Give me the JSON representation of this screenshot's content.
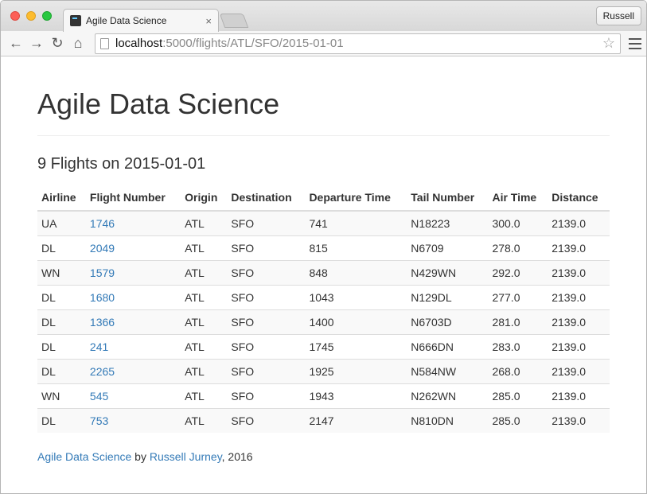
{
  "browser": {
    "tab_title": "Agile Data Science",
    "tab_close": "×",
    "profile": "Russell",
    "url_host": "localhost",
    "url_path": ":5000/flights/ATL/SFO/2015-01-01"
  },
  "page": {
    "heading": "Agile Data Science",
    "subheading": "9 Flights on 2015-01-01"
  },
  "table": {
    "headers": [
      "Airline",
      "Flight Number",
      "Origin",
      "Destination",
      "Departure Time",
      "Tail Number",
      "Air Time",
      "Distance"
    ],
    "rows": [
      [
        "UA",
        "1746",
        "ATL",
        "SFO",
        "741",
        "N18223",
        "300.0",
        "2139.0"
      ],
      [
        "DL",
        "2049",
        "ATL",
        "SFO",
        "815",
        "N6709",
        "278.0",
        "2139.0"
      ],
      [
        "WN",
        "1579",
        "ATL",
        "SFO",
        "848",
        "N429WN",
        "292.0",
        "2139.0"
      ],
      [
        "DL",
        "1680",
        "ATL",
        "SFO",
        "1043",
        "N129DL",
        "277.0",
        "2139.0"
      ],
      [
        "DL",
        "1366",
        "ATL",
        "SFO",
        "1400",
        "N6703D",
        "281.0",
        "2139.0"
      ],
      [
        "DL",
        "241",
        "ATL",
        "SFO",
        "1745",
        "N666DN",
        "283.0",
        "2139.0"
      ],
      [
        "DL",
        "2265",
        "ATL",
        "SFO",
        "1925",
        "N584NW",
        "268.0",
        "2139.0"
      ],
      [
        "WN",
        "545",
        "ATL",
        "SFO",
        "1943",
        "N262WN",
        "285.0",
        "2139.0"
      ],
      [
        "DL",
        "753",
        "ATL",
        "SFO",
        "2147",
        "N810DN",
        "285.0",
        "2139.0"
      ]
    ]
  },
  "footer": {
    "site_link": "Agile Data Science",
    "by": " by ",
    "author_link": "Russell Jurney",
    "year": ", 2016"
  },
  "colors": {
    "link": "#337ab7",
    "stripe": "#f9f9f9"
  }
}
